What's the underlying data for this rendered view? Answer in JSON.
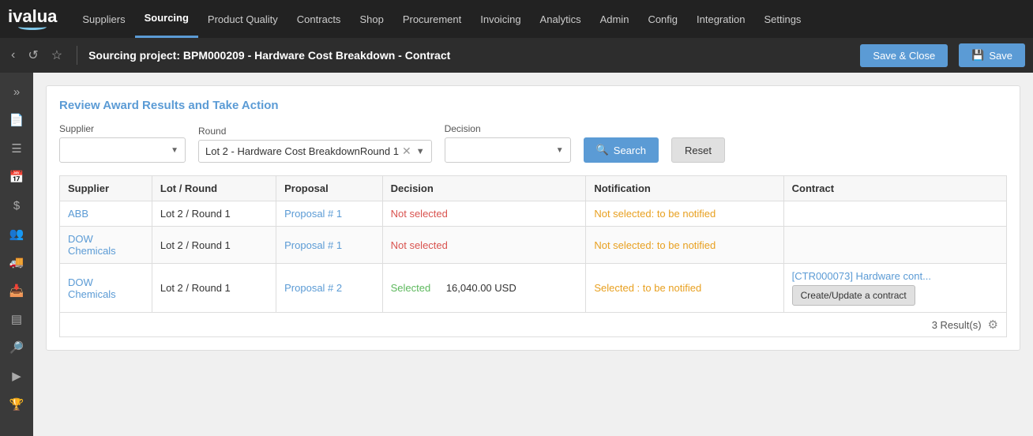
{
  "nav": {
    "logo": "ivalua",
    "items": [
      {
        "label": "Suppliers",
        "active": false
      },
      {
        "label": "Sourcing",
        "active": true
      },
      {
        "label": "Product Quality",
        "active": false
      },
      {
        "label": "Contracts",
        "active": false
      },
      {
        "label": "Shop",
        "active": false
      },
      {
        "label": "Procurement",
        "active": false
      },
      {
        "label": "Invoicing",
        "active": false
      },
      {
        "label": "Analytics",
        "active": false
      },
      {
        "label": "Admin",
        "active": false
      },
      {
        "label": "Config",
        "active": false
      },
      {
        "label": "Integration",
        "active": false
      },
      {
        "label": "Settings",
        "active": false
      }
    ]
  },
  "secondBar": {
    "title": "Sourcing project: BPM000209 - Hardware Cost Breakdown - Contract",
    "saveCloseLabel": "Save & Close",
    "saveLabel": "Save"
  },
  "section": {
    "title": "Review Award Results and Take Action",
    "filters": {
      "supplierLabel": "Supplier",
      "supplierPlaceholder": "",
      "roundLabel": "Round",
      "roundValue": "Lot 2 - Hardware Cost BreakdownRound 1",
      "decisionLabel": "Decision",
      "decisionPlaceholder": "",
      "searchLabel": "Search",
      "resetLabel": "Reset"
    },
    "table": {
      "headers": [
        "Supplier",
        "Lot / Round",
        "Proposal",
        "Decision",
        "Notification",
        "Contract"
      ],
      "rows": [
        {
          "supplier": "ABB",
          "lotRound": "Lot 2 / Round 1",
          "proposal": "Proposal # 1",
          "decision": "Not selected",
          "decisionColor": "red",
          "amount": "",
          "notification": "Not selected: to be notified",
          "notificationColor": "orange",
          "contract": "",
          "contractLink": "",
          "hasCreateButton": false
        },
        {
          "supplier": "DOW Chemicals",
          "lotRound": "Lot 2 / Round 1",
          "proposal": "Proposal # 1",
          "decision": "Not selected",
          "decisionColor": "red",
          "amount": "",
          "notification": "Not selected: to be notified",
          "notificationColor": "orange",
          "contract": "",
          "contractLink": "",
          "hasCreateButton": false
        },
        {
          "supplier": "DOW Chemicals",
          "lotRound": "Lot 2 / Round 1",
          "proposal": "Proposal # 2",
          "decision": "Selected",
          "decisionColor": "green",
          "amount": "16,040.00 USD",
          "notification": "Selected : to be notified",
          "notificationColor": "orange",
          "contract": "[CTR000073] Hardware cont...",
          "contractLink": "[CTR000073] Hardware cont...",
          "hasCreateButton": true,
          "createButtonLabel": "Create/Update a contract"
        }
      ],
      "footer": {
        "resultsCount": "3 Result(s)"
      }
    }
  }
}
